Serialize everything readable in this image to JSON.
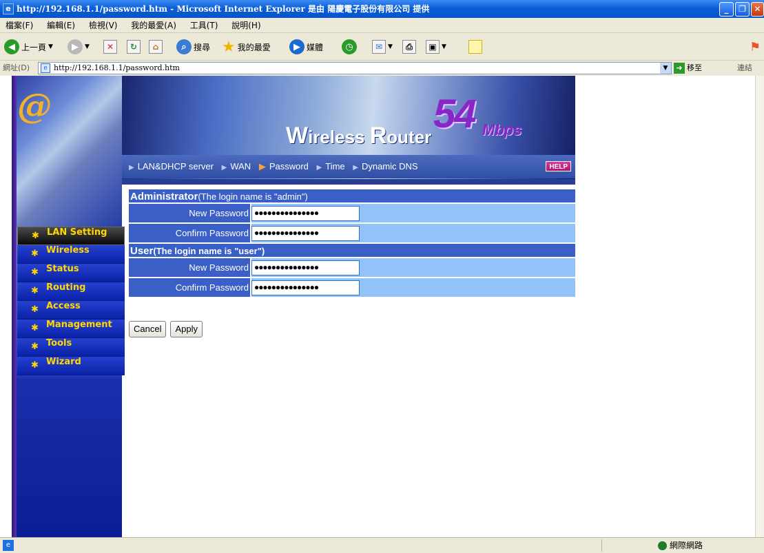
{
  "window": {
    "title": "http://192.168.1.1/password.htm - Microsoft Internet Explorer 是由 陽慶電子股份有限公司 提供"
  },
  "menu": [
    "檔案(F)",
    "編輯(E)",
    "檢視(V)",
    "我的最愛(A)",
    "工具(T)",
    "說明(H)"
  ],
  "toolbar": {
    "back": "上一頁",
    "search": "搜尋",
    "favorites": "我的最愛",
    "media": "媒體"
  },
  "address": {
    "label": "網址(D)",
    "url": "http://192.168.1.1/password.htm",
    "go": "移至",
    "links": "連結"
  },
  "sidebar": {
    "items": [
      {
        "label": "LAN Setting",
        "active": true
      },
      {
        "label": "Wireless"
      },
      {
        "label": "Status"
      },
      {
        "label": "Routing"
      },
      {
        "label": "Access"
      },
      {
        "label": "Management"
      },
      {
        "label": "Tools"
      },
      {
        "label": "Wizard"
      }
    ]
  },
  "banner": {
    "title_w": "W",
    "title_rest1": "ireless ",
    "title_r": "R",
    "title_rest2": "outer",
    "speed": "54",
    "unit": "Mbps",
    "nav": [
      "LAN&DHCP server",
      "WAN",
      "Password",
      "Time",
      "Dynamic DNS"
    ],
    "current": "Password",
    "help": "HELP"
  },
  "form": {
    "admin_heading": "Administrator",
    "admin_note": "(The login name is \"admin\")",
    "admin_new_label": "New Password",
    "admin_new_value": "●●●●●●●●●●●●●●●",
    "admin_confirm_label": "Confirm Password",
    "admin_confirm_value": "●●●●●●●●●●●●●●●",
    "user_heading": "User",
    "user_note": "(The login name is \"user\")",
    "user_new_label": "New Password",
    "user_new_value": "●●●●●●●●●●●●●●●",
    "user_confirm_label": "Confirm Password",
    "user_confirm_value": "●●●●●●●●●●●●●●●"
  },
  "buttons": {
    "cancel": "Cancel",
    "apply": "Apply"
  },
  "status": {
    "zone": "網際網路"
  }
}
